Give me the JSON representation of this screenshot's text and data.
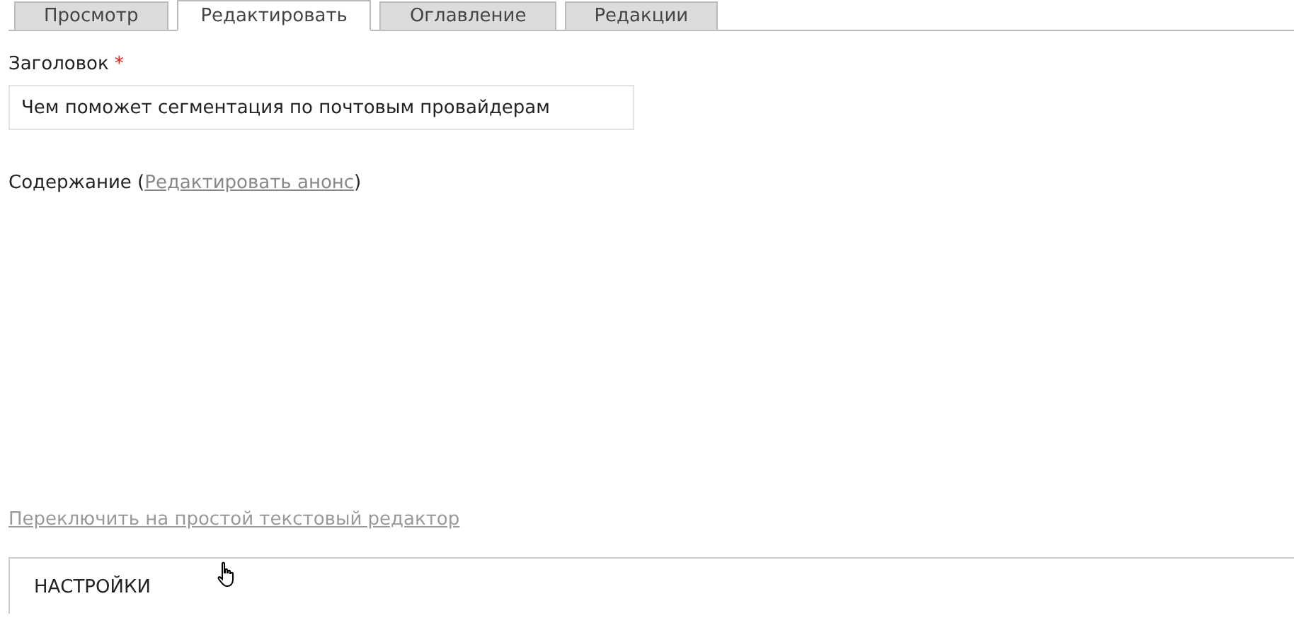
{
  "tabs": [
    {
      "label": "Просмотр",
      "selected": false
    },
    {
      "label": "Редактировать",
      "selected": true
    },
    {
      "label": "Оглавление",
      "selected": false
    },
    {
      "label": "Редакции",
      "selected": false
    }
  ],
  "title_field": {
    "label": "Заголовок",
    "required_mark": "*",
    "value": "Чем поможет сегментация по почтовым провайдерам"
  },
  "content": {
    "label": "Содержание (",
    "link": "Редактировать анонс",
    "suffix": ")"
  },
  "editor_switch_link": "Переключить на простой текстовый редактор",
  "settings": {
    "title": "НАСТРОЙКИ"
  }
}
